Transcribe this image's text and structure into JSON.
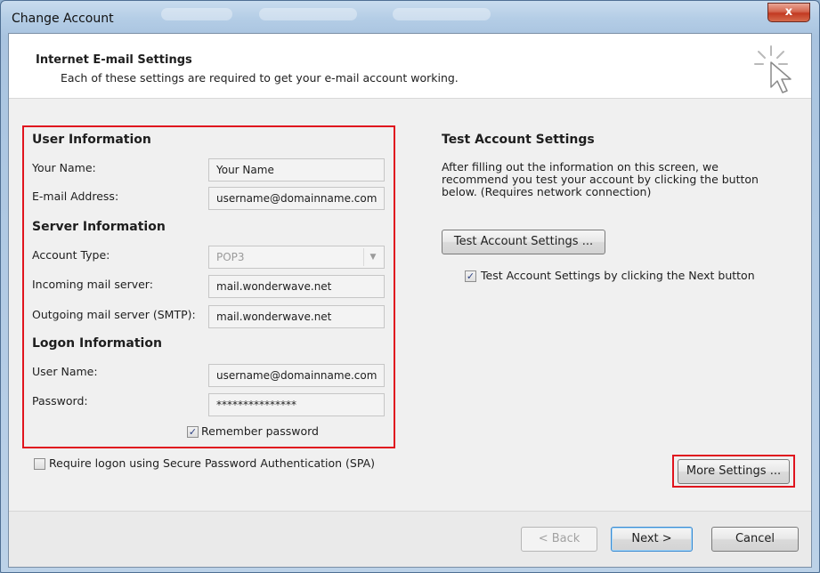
{
  "window": {
    "title": "Change Account",
    "close_label": "x"
  },
  "header": {
    "title": "Internet E-mail Settings",
    "subtitle": "Each of these settings are required to get your e-mail account working.",
    "icon": "cursor-click-icon"
  },
  "user_info": {
    "heading": "User Information",
    "your_name_label": "Your Name:",
    "your_name_value": "Your Name",
    "email_label": "E-mail Address:",
    "email_value": "username@domainname.com"
  },
  "server_info": {
    "heading": "Server Information",
    "account_type_label": "Account Type:",
    "account_type_value": "POP3",
    "incoming_label": "Incoming mail server:",
    "incoming_value": "mail.wonderwave.net",
    "outgoing_label": "Outgoing mail server (SMTP):",
    "outgoing_value": "mail.wonderwave.net"
  },
  "logon_info": {
    "heading": "Logon Information",
    "username_label": "User Name:",
    "username_value": "username@domainname.com",
    "password_label": "Password:",
    "password_value": "***************",
    "remember_label": "Remember password",
    "remember_checked": true
  },
  "spa": {
    "label": "Require logon using Secure Password Authentication (SPA)",
    "checked": false
  },
  "test": {
    "heading": "Test Account Settings",
    "description": "After filling out the information on this screen, we recommend you test your account by clicking the button below. (Requires network connection)",
    "button_label": "Test Account Settings ...",
    "checkbox_label": "Test Account Settings by clicking the Next button",
    "checkbox_checked": true
  },
  "buttons": {
    "more_settings": "More Settings ...",
    "back": "< Back",
    "next": "Next >",
    "cancel": "Cancel"
  },
  "colors": {
    "highlight_frame": "#e0141e",
    "titlebar": "#b4cde6",
    "close": "#c33a22"
  }
}
